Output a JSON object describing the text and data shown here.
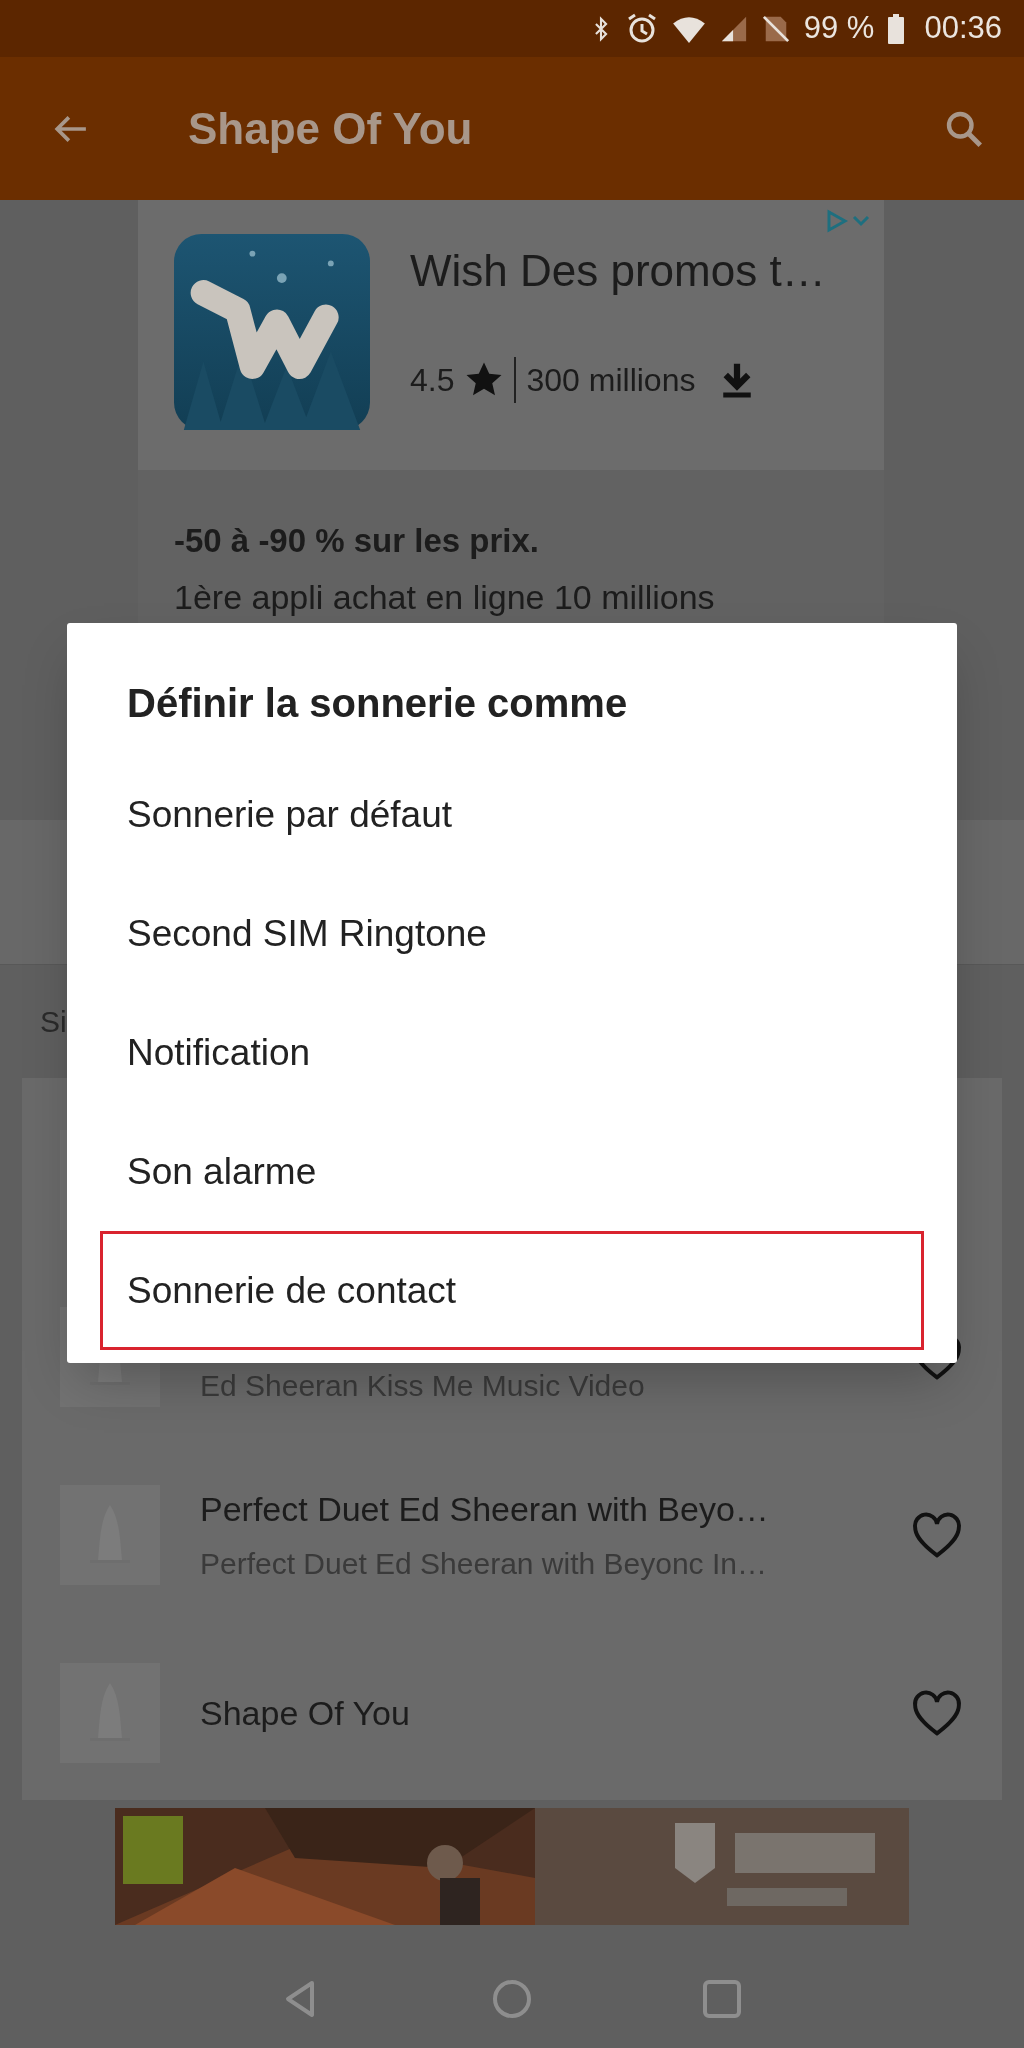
{
  "status_bar": {
    "battery": "99 %",
    "time": "00:36"
  },
  "app_bar": {
    "title": "Shape Of You"
  },
  "ad": {
    "title": "Wish Des promos t…",
    "rating": "4.5",
    "downloads": "300 millions",
    "headline": "-50 à -90 % sur les prix.",
    "body": "1ère appli achat en ligne 10 millions"
  },
  "section_label": "Si",
  "songs": [
    {
      "subtitle": "Ed Sheeran Kiss Me Music Video"
    },
    {
      "title": "Perfect Duet Ed Sheeran with Beyo…",
      "subtitle": "Perfect Duet Ed Sheeran with Beyonc In…"
    },
    {
      "title": "Shape Of You"
    }
  ],
  "dialog": {
    "title": "Définir la sonnerie comme",
    "options": [
      {
        "label": "Sonnerie par défaut",
        "selected": false
      },
      {
        "label": "Second SIM Ringtone",
        "selected": false
      },
      {
        "label": "Notification",
        "selected": false
      },
      {
        "label": "Son alarme",
        "selected": false
      },
      {
        "label": "Sonnerie de contact",
        "selected": true
      }
    ]
  }
}
